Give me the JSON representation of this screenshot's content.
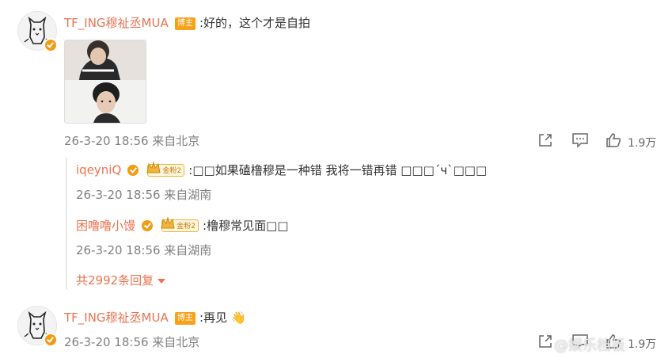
{
  "comment1": {
    "username": "TF_ING穆祉丞MUA",
    "badge": "博主",
    "text": ":好的，这个才是自拍",
    "time": "26-3-20 18:56 来自北京",
    "likes": "1.9万"
  },
  "replies": [
    {
      "username": "iqeyniQ",
      "fan_level": "金粉2",
      "text": ":□□如果磕橹穆是一种错 我将一错再错 □□□´ч`□□□",
      "time": "26-3-20 18:56 来自湖南"
    },
    {
      "username": "困噜噜小馒",
      "fan_level": "金粉2",
      "text": ":橹穆常见面□□",
      "time": "26-3-20 18:56 来自湖南"
    }
  ],
  "more_replies": "共2992条回复",
  "comment2": {
    "username": "TF_ING穆祉丞MUA",
    "badge": "博主",
    "text": ":再见",
    "emoji": "👋",
    "time": "26-3-20 18:56 来自北京",
    "likes": "1.9万"
  },
  "watermark": "@娱乐档板",
  "colors": {
    "name": "#eb7350",
    "time": "#808080",
    "blogger_badge": "#f7a21b",
    "verified": "#f39b12"
  }
}
